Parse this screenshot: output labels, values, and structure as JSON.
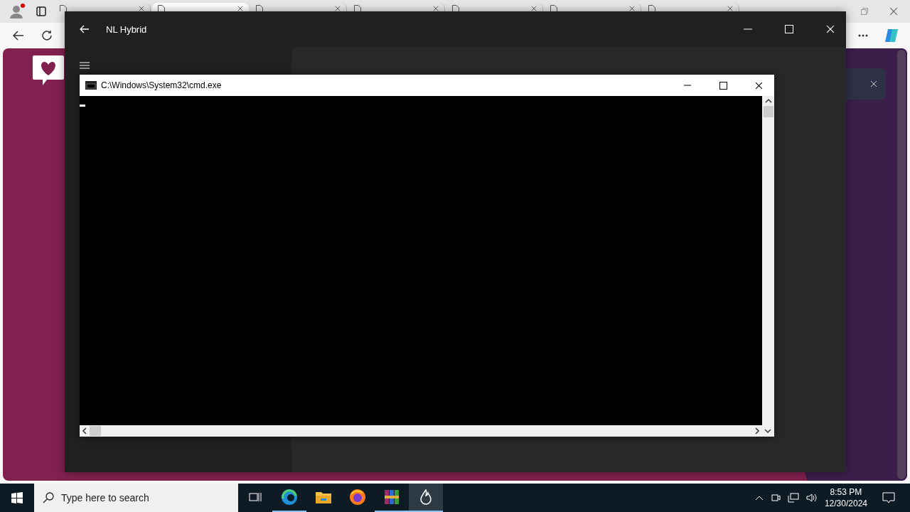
{
  "browser": {
    "tabs": [
      {
        "selected": false
      },
      {
        "selected": true
      },
      {
        "selected": false
      },
      {
        "selected": false
      },
      {
        "selected": false
      },
      {
        "selected": false
      },
      {
        "selected": false
      }
    ]
  },
  "app_window": {
    "title": "NL Hybrid"
  },
  "console_window": {
    "title": "C:\\Windows\\System32\\cmd.exe"
  },
  "taskbar": {
    "search": {
      "placeholder": "Type here to search"
    },
    "apps": [
      {
        "kind": "taskview",
        "running": false,
        "active": false
      },
      {
        "kind": "edge",
        "running": true,
        "active": false
      },
      {
        "kind": "folder",
        "running": false,
        "active": false
      },
      {
        "kind": "firefox",
        "running": false,
        "active": false
      },
      {
        "kind": "archive",
        "running": true,
        "active": false
      },
      {
        "kind": "flame",
        "running": true,
        "active": true
      }
    ],
    "time": "8:53 PM",
    "date": "12/30/2024"
  }
}
